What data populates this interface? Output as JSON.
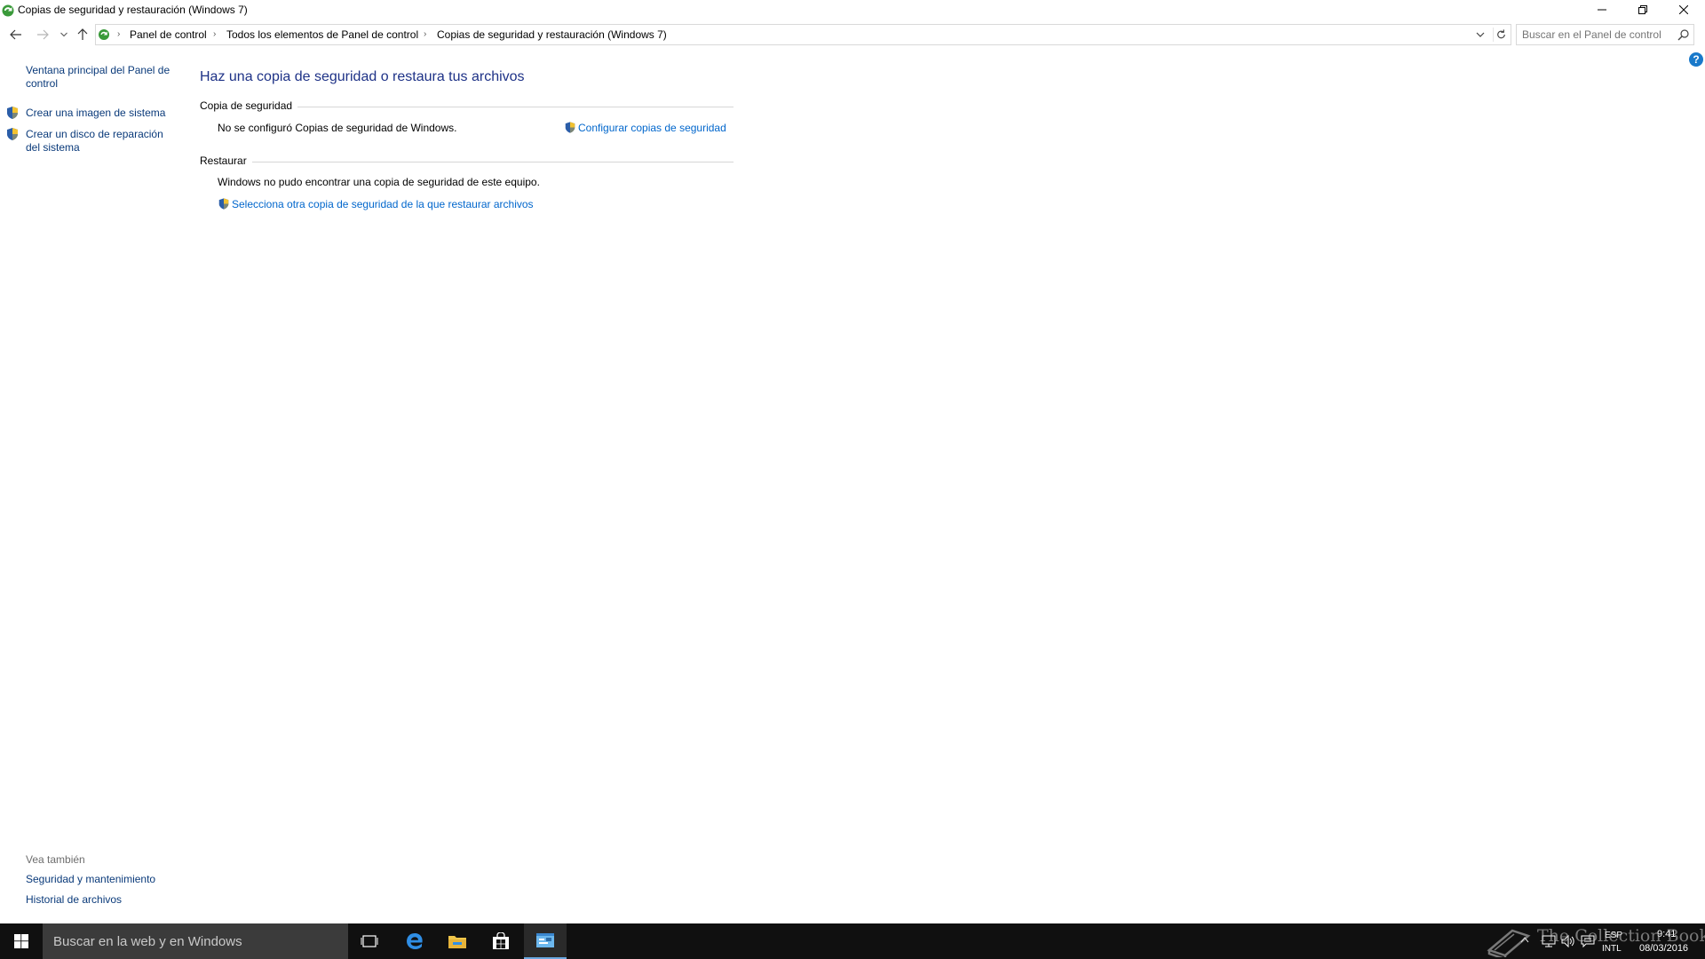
{
  "window": {
    "title": "Copias de seguridad y restauración (Windows 7)"
  },
  "navigation": {
    "breadcrumbs": [
      "Panel de control",
      "Todos los elementos de Panel de control",
      "Copias de seguridad y restauración (Windows 7)"
    ],
    "search_placeholder": "Buscar en el Panel de control"
  },
  "sidebar": {
    "home_link": "Ventana principal del Panel de control",
    "home_link_line1": "Ventana principal del Panel de",
    "home_link_line2": "control",
    "create_image": "Crear una imagen de sistema",
    "repair_disc_line1": "Crear un disco de reparación",
    "repair_disc_line2": "del sistema",
    "see_also_title": "Vea también",
    "see_also": [
      "Seguridad y mantenimiento",
      "Historial de archivos"
    ]
  },
  "main": {
    "title": "Haz una copia de seguridad o restaura tus archivos",
    "backup": {
      "label": "Copia de seguridad",
      "status": "No se configuró Copias de seguridad de Windows.",
      "configure_link": "Configurar copias de seguridad"
    },
    "restore": {
      "label": "Restaurar",
      "status": "Windows no pudo encontrar una copia de seguridad de este equipo.",
      "select_link": "Selecciona otra copia de seguridad de la que restaurar archivos"
    }
  },
  "taskbar": {
    "search_text": "Buscar en la web y en Windows",
    "language_top": "ESP",
    "language_bottom": "INTL",
    "time": "9:41",
    "date": "08/03/2016",
    "watermark": "The Collection Book"
  },
  "colors": {
    "link": "#0066cc",
    "title": "#1e3287",
    "taskbar": "#101010"
  }
}
